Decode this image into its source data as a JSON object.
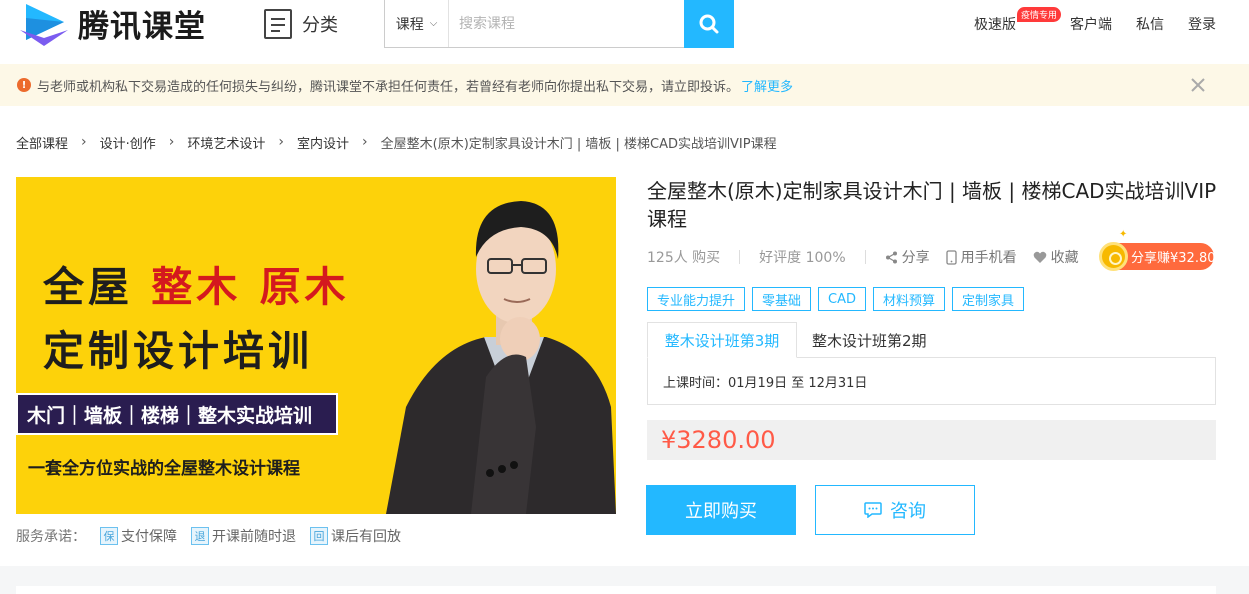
{
  "header": {
    "brand": "腾讯课堂",
    "category_label": "分类",
    "search": {
      "type_label": "课程",
      "placeholder": "搜索课程"
    },
    "nav": {
      "fast": "极速版",
      "fast_badge": "疫情专用",
      "client": "客户端",
      "messages": "私信",
      "login": "登录"
    }
  },
  "notice": {
    "text": "与老师或机构私下交易造成的任何损失与纠纷，腾讯课堂不承担任何责任，若曾经有老师向你提出私下交易，请立即投诉。",
    "link": "了解更多"
  },
  "breadcrumb": [
    "全部课程",
    "设计·创作",
    "环境艺术设计",
    "室内设计",
    "全屋整木(原木)定制家具设计木门 | 墙板 | 楼梯CAD实战培训VIP课程"
  ],
  "banner": {
    "line1_a": "全屋",
    "line1_b": "整木",
    "line1_c": "原木",
    "line2": "定制设计培训",
    "box": "木门｜墙板｜楼梯｜整木实战培训",
    "line3": "一套全方位实战的全屋整木设计课程"
  },
  "service": {
    "label": "服务承诺：",
    "items": [
      {
        "icon": "保",
        "label": "支付保障"
      },
      {
        "icon": "退",
        "label": "开课前随时退"
      },
      {
        "icon": "回",
        "label": "课后有回放"
      }
    ]
  },
  "course": {
    "title": "全屋整木(原木)定制家具设计木门 | 墙板 | 楼梯CAD实战培训VIP课程",
    "buyers": "125人 购买",
    "rating": "好评度 100%",
    "share": "分享",
    "mobile": "用手机看",
    "favorite": "收藏",
    "share_earn": "分享赚¥32.80",
    "tags": [
      "专业能力提升",
      "零基础",
      "CAD",
      "材料预算",
      "定制家具"
    ],
    "classes": [
      "整木设计班第3期",
      "整木设计班第2期"
    ],
    "schedule": "上课时间：01月19日 至 12月31日",
    "price": "¥3280.00",
    "buy_label": "立即购买",
    "consult_label": "咨询"
  },
  "colors": {
    "accent": "#23b8ff",
    "price": "#ff5a47",
    "banner_bg": "#fdd20a",
    "banner_red": "#d4191e"
  }
}
